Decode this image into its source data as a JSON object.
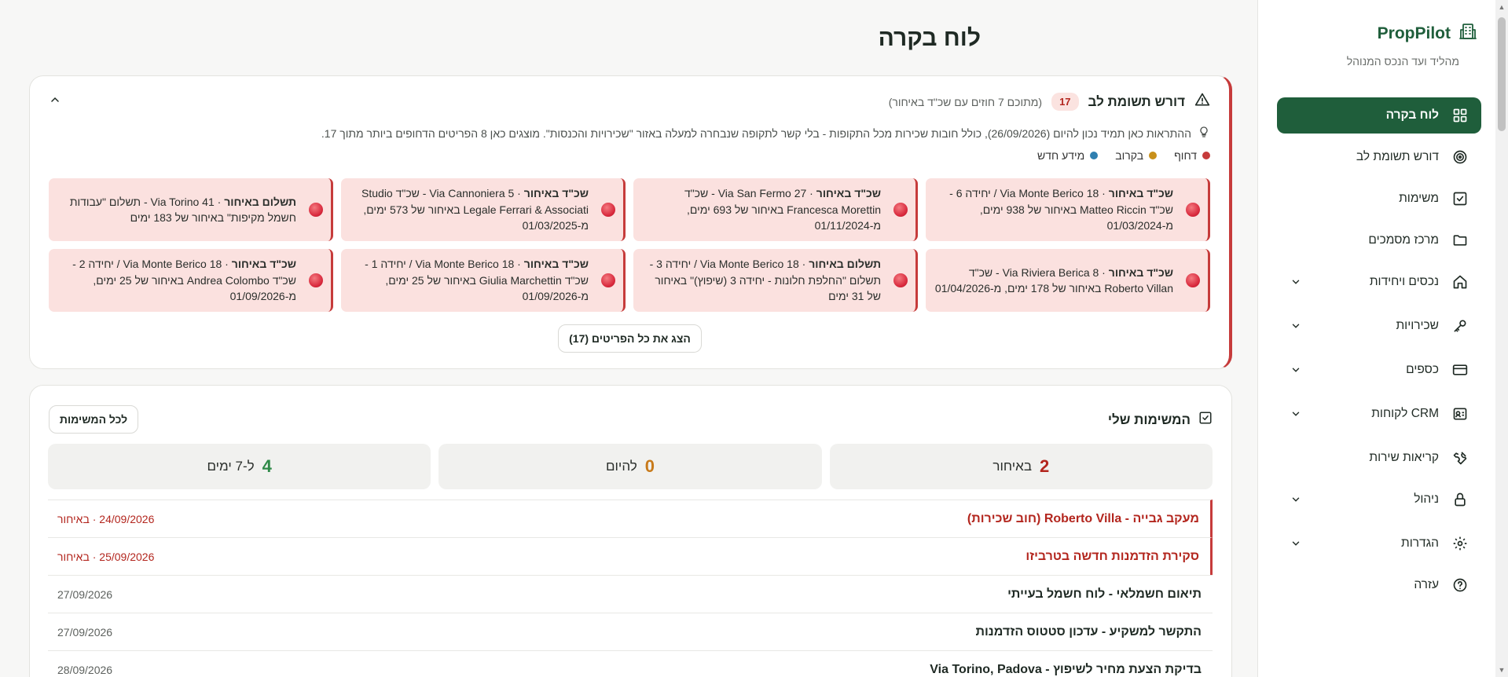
{
  "app": {
    "brand_name": "PropPilot",
    "brand_subtitle": "מהליד ועד הנכס המנוהל"
  },
  "sidebar": {
    "items": [
      {
        "label": "לוח בקרה",
        "icon": "dashboard-icon",
        "active": true,
        "has_chevron": false
      },
      {
        "label": "דורש תשומת לב",
        "icon": "target-icon",
        "active": false,
        "has_chevron": false
      },
      {
        "label": "משימות",
        "icon": "checkbox-icon",
        "active": false,
        "has_chevron": false
      },
      {
        "label": "מרכז מסמכים",
        "icon": "folder-icon",
        "active": false,
        "has_chevron": false
      },
      {
        "label": "נכסים ויחידות",
        "icon": "home-icon",
        "active": false,
        "has_chevron": true
      },
      {
        "label": "שכירויות",
        "icon": "key-icon",
        "active": false,
        "has_chevron": true
      },
      {
        "label": "כספים",
        "icon": "credit-card-icon",
        "active": false,
        "has_chevron": true
      },
      {
        "label": "CRM לקוחות",
        "icon": "contact-card-icon",
        "active": false,
        "has_chevron": true
      },
      {
        "label": "קריאות שירות",
        "icon": "wrench-icon",
        "active": false,
        "has_chevron": false
      },
      {
        "label": "ניהול",
        "icon": "lock-icon",
        "active": false,
        "has_chevron": true
      },
      {
        "label": "הגדרות",
        "icon": "gear-icon",
        "active": false,
        "has_chevron": true
      },
      {
        "label": "עזרה",
        "icon": "help-circle-icon",
        "active": false,
        "has_chevron": false
      }
    ]
  },
  "page": {
    "title": "לוח בקרה"
  },
  "attention": {
    "title": "דורש תשומת לב",
    "count": "17",
    "subtitle": "(מתוכם 7 חוזים עם שכ\"ד באיחור)",
    "note": "ההתראות כאן תמיד נכון להיום (26/09/2026), כולל חובות שכירות מכל התקופות - בלי קשר לתקופה שנבחרה למעלה באזור \"שכירויות והכנסות\". מוצגים כאן 8 הפריטים הדחופים ביותר מתוך 17.",
    "legend": [
      {
        "label": "דחוף",
        "color": "#c63b3b"
      },
      {
        "label": "בקרוב",
        "color": "#c8901a"
      },
      {
        "label": "מידע חדש",
        "color": "#2f7fb0"
      }
    ],
    "alerts": [
      {
        "kind": "שכ\"ד באיחור",
        "text": " · Via Monte Berico 18 / יחידה 6 - שכ\"ד Matteo Riccin באיחור של 938 ימים, מ-01/03/2024"
      },
      {
        "kind": "שכ\"ד באיחור",
        "text": " · Via San Fermo 27 - שכ\"ד Francesca Morettin באיחור של 693 ימים, מ-01/11/2024"
      },
      {
        "kind": "שכ\"ד באיחור",
        "text": " · Via Cannoniera 5 - שכ\"ד Studio Legale Ferrari & Associati באיחור של 573 ימים, מ-01/03/2025"
      },
      {
        "kind": "תשלום באיחור",
        "text": " · Via Torino 41 - תשלום \"עבודות חשמל מקיפות\" באיחור של 183 ימים"
      },
      {
        "kind": "שכ\"ד באיחור",
        "text": " · Via Riviera Berica 8 - שכ\"ד Roberto Villan באיחור של 178 ימים, מ-01/04/2026"
      },
      {
        "kind": "תשלום באיחור",
        "text": " · Via Monte Berico 18 / יחידה 3 - תשלום \"החלפת חלונות - יחידה 3 (שיפוץ)\" באיחור של 31 ימים"
      },
      {
        "kind": "שכ\"ד באיחור",
        "text": " · Via Monte Berico 18 / יחידה 1 - שכ\"ד Giulia Marchettin באיחור של 25 ימים, מ-01/09/2026"
      },
      {
        "kind": "שכ\"ד באיחור",
        "text": " · Via Monte Berico 18 / יחידה 2 - שכ\"ד Andrea Colombo באיחור של 25 ימים, מ-01/09/2026"
      }
    ],
    "show_all_label": "הצג את כל הפריטים (17)"
  },
  "tasks": {
    "title": "המשימות שלי",
    "all_tasks_label": "לכל המשימות",
    "stats": [
      {
        "num": "2",
        "label": "באיחור",
        "tone": "red"
      },
      {
        "num": "0",
        "label": "להיום",
        "tone": "orange"
      },
      {
        "num": "4",
        "label": "ל-7 ימים",
        "tone": "green"
      }
    ],
    "rows": [
      {
        "title": "מעקב גבייה - Roberto Villa (חוב שכירות)",
        "meta": "24/09/2026 · באיחור",
        "overdue": true
      },
      {
        "title": "סקירת הזדמנות חדשה בטרביזו",
        "meta": "25/09/2026 · באיחור",
        "overdue": true
      },
      {
        "title": "תיאום חשמלאי - לוח חשמל בעייתי",
        "meta": "27/09/2026",
        "overdue": false
      },
      {
        "title": "התקשר למשקיע - עדכון סטטוס הזדמנות",
        "meta": "27/09/2026",
        "overdue": false
      },
      {
        "title": "בדיקת הצעת מחיר לשיפוץ - Via Torino, Padova",
        "meta": "28/09/2026",
        "overdue": false
      }
    ]
  }
}
